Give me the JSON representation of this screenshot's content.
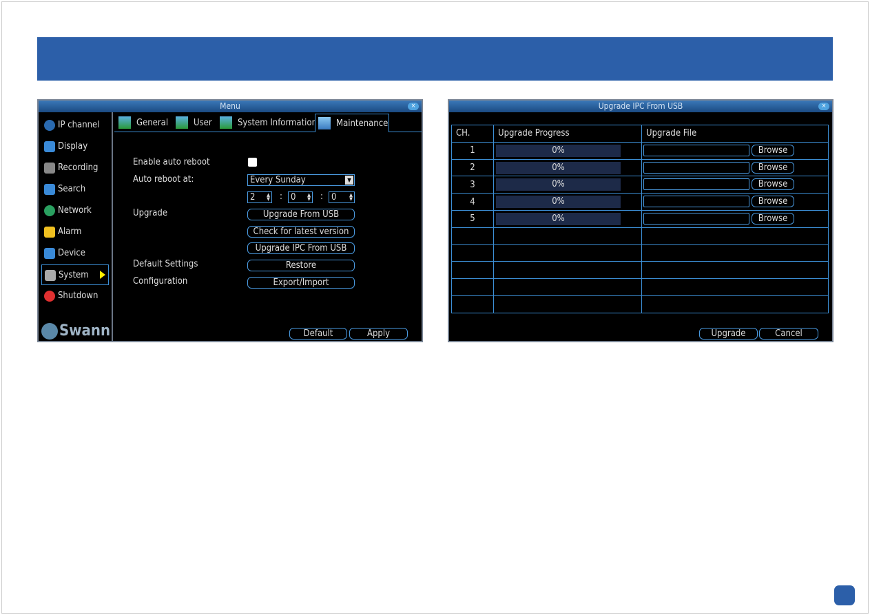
{
  "left_window": {
    "title": "Menu",
    "sidebar": [
      {
        "label": "IP channel",
        "icon": "ip-camera-icon"
      },
      {
        "label": "Display",
        "icon": "display-icon"
      },
      {
        "label": "Recording",
        "icon": "recording-icon"
      },
      {
        "label": "Search",
        "icon": "search-icon"
      },
      {
        "label": "Network",
        "icon": "network-icon"
      },
      {
        "label": "Alarm",
        "icon": "alarm-icon"
      },
      {
        "label": "Device",
        "icon": "device-icon"
      },
      {
        "label": "System",
        "icon": "gear-icon",
        "selected": true
      },
      {
        "label": "Shutdown",
        "icon": "power-icon"
      }
    ],
    "logo": "Swann",
    "tabs": [
      {
        "label": "General"
      },
      {
        "label": "User"
      },
      {
        "label": "System Information"
      },
      {
        "label": "Maintenance",
        "active": true
      }
    ],
    "form": {
      "enable_auto_reboot_label": "Enable auto reboot",
      "enable_auto_reboot": false,
      "auto_reboot_at_label": "Auto reboot at:",
      "auto_reboot_day": "Every Sunday",
      "hour": "2",
      "minute": "0",
      "second": "0",
      "sep": ":",
      "upgrade_label": "Upgrade",
      "upgrade_usb": "Upgrade From USB",
      "check_latest": "Check for latest version",
      "upgrade_ipc": "Upgrade IPC From USB",
      "default_settings_label": "Default Settings",
      "restore": "Restore",
      "configuration_label": "Configuration",
      "export_import": "Export/Import"
    },
    "default_btn": "Default",
    "apply_btn": "Apply"
  },
  "right_window": {
    "title": "Upgrade IPC From USB",
    "columns": [
      "CH.",
      "Upgrade Progress",
      "Upgrade File"
    ],
    "rows": [
      {
        "ch": "1",
        "progress": "0%",
        "browse": "Browse"
      },
      {
        "ch": "2",
        "progress": "0%",
        "browse": "Browse"
      },
      {
        "ch": "3",
        "progress": "0%",
        "browse": "Browse"
      },
      {
        "ch": "4",
        "progress": "0%",
        "browse": "Browse"
      },
      {
        "ch": "5",
        "progress": "0%",
        "browse": "Browse"
      }
    ],
    "upgrade_btn": "Upgrade",
    "cancel_btn": "Cancel"
  },
  "colors": {
    "brand_blue": "#2c5fa9",
    "ui_border": "#4a9ae0",
    "selected_arrow": "#ffee00"
  }
}
